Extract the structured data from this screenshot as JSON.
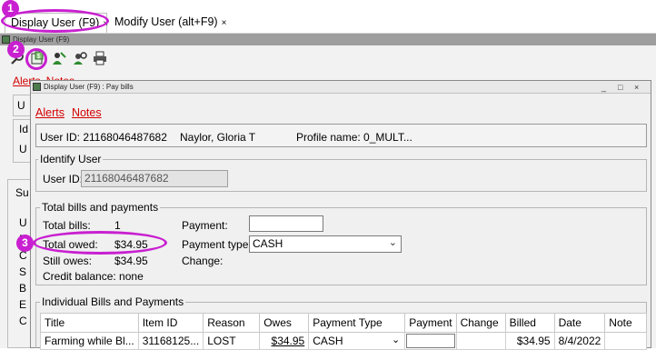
{
  "tabs": [
    {
      "label": "Display User (F9)",
      "close": "×"
    },
    {
      "label": "Modify User (alt+F9)",
      "close": "×"
    }
  ],
  "annotations": [
    "1",
    "2",
    "3"
  ],
  "inner_window_title": "Display User (F9)",
  "toolbar_icons": [
    "search-user-icon",
    "pay-bills-icon",
    "user-edit-icon",
    "user-lookup-icon",
    "print-icon"
  ],
  "background": {
    "links": [
      "Alerts",
      "Notes"
    ],
    "fragments": [
      "U",
      "Id",
      "U",
      "Su",
      "U",
      "F",
      "C",
      "S",
      "B",
      "E",
      "C"
    ]
  },
  "dialog": {
    "title": "Display User (F9) : Pay bills",
    "window_buttons": [
      "_",
      "□",
      "×"
    ],
    "links": [
      "Alerts",
      "Notes"
    ],
    "user_bar": {
      "user_id_text": "User ID: 21168046487682",
      "name": "Naylor, Gloria T",
      "profile": "Profile name: 0_MULT..."
    },
    "identify": {
      "title": "Identify User",
      "user_id_label": "User ID:",
      "user_id_value": "21168046487682"
    },
    "totals": {
      "title": "Total bills and payments",
      "total_bills_label": "Total bills:",
      "total_bills_value": "1",
      "total_owed_label": "Total owed:",
      "total_owed_value": "$34.95",
      "still_owes_label": "Still owes:",
      "still_owes_value": "$34.95",
      "credit_balance": "Credit balance: none",
      "payment_label": "Payment:",
      "payment_value": "",
      "payment_type_label": "Payment type:",
      "payment_type_value": "CASH",
      "change_label": "Change:"
    },
    "individual": {
      "title": "Individual Bills and Payments",
      "columns": [
        "Title",
        "Item ID",
        "Reason",
        "Owes",
        "Payment Type",
        "Payment",
        "Change",
        "Billed",
        "Date",
        "Note"
      ],
      "rows": [
        {
          "title": "Farming while Bl...",
          "item_id": "31168125...",
          "reason": "LOST",
          "owes": "$34.95",
          "payment_type": "CASH",
          "payment": "",
          "change": "",
          "billed": "$34.95",
          "date": "8/4/2022",
          "note": ""
        }
      ]
    }
  },
  "colors": {
    "annotation": "#c81fd0",
    "link": "#d40000"
  }
}
